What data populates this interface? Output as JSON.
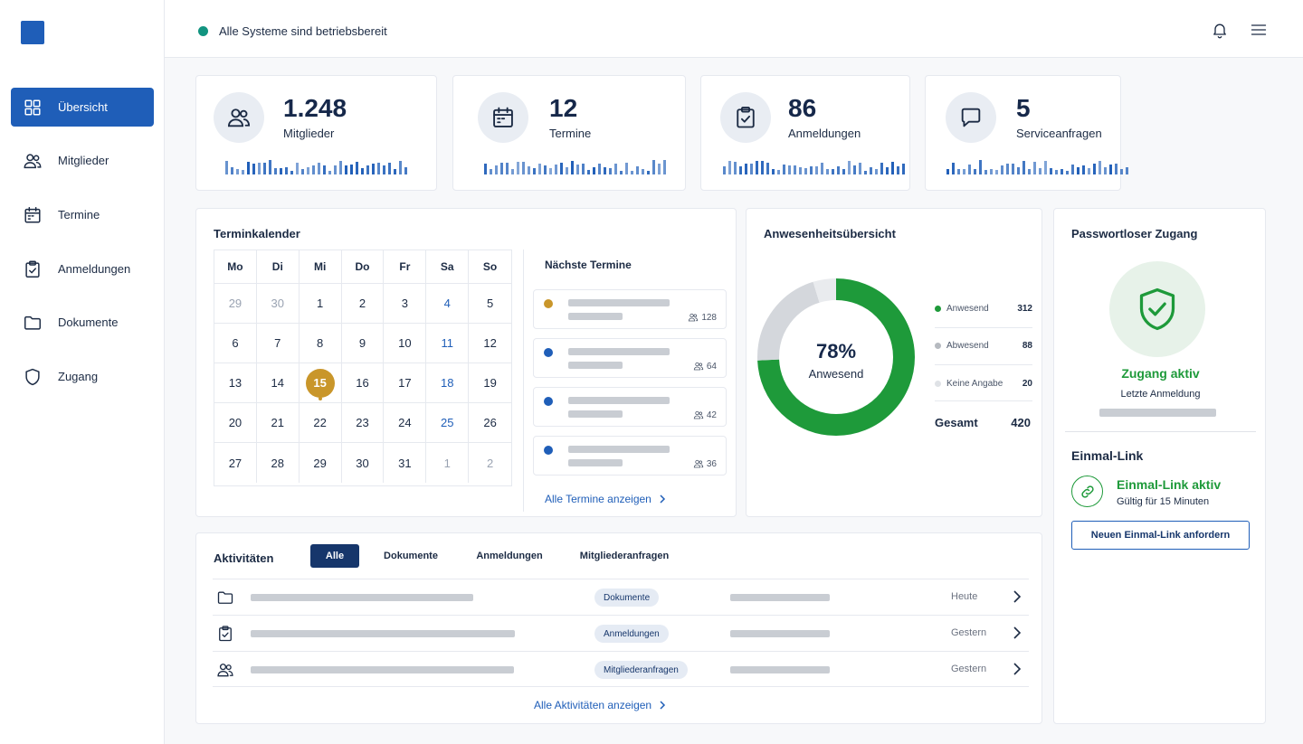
{
  "colors": {
    "primary": "#1f5eb8",
    "dark": "#16366b",
    "status_ok": "#129480",
    "present": "#1e9a3a",
    "absent": "#c0c4ca",
    "unknown": "#e3e6ea",
    "today": "#c9962a"
  },
  "sidebar": {
    "items": [
      {
        "label": "Übersicht",
        "icon": "grid-icon",
        "active": true
      },
      {
        "label": "Mitglieder",
        "icon": "users-icon"
      },
      {
        "label": "Termine",
        "icon": "calendar-icon"
      },
      {
        "label": "Anmeldungen",
        "icon": "clipboard-check-icon"
      },
      {
        "label": "Dokumente",
        "icon": "folder-icon"
      },
      {
        "label": "Zugang",
        "icon": "shield-icon"
      }
    ]
  },
  "topbar": {
    "status": "Alle Systeme sind betriebsbereit"
  },
  "stats": [
    {
      "value": "1.248",
      "label": "Mitglieder",
      "icon": "users-icon"
    },
    {
      "value": "12",
      "label": "Termine",
      "icon": "calendar-icon"
    },
    {
      "value": "86",
      "label": "Anmeldungen",
      "icon": "clipboard-check-icon"
    },
    {
      "value": "5",
      "label": "Serviceanfragen",
      "icon": "chat-icon"
    }
  ],
  "calendar": {
    "title": "Terminkalender",
    "weekdays": [
      "Mo",
      "Di",
      "Mi",
      "Do",
      "Fr",
      "Sa",
      "So"
    ],
    "weeks": [
      [
        "29",
        "30",
        "1",
        "2",
        "3",
        "4",
        "5"
      ],
      [
        "6",
        "7",
        "8",
        "9",
        "10",
        "11",
        "12"
      ],
      [
        "13",
        "14",
        "15",
        "16",
        "17",
        "18",
        "19"
      ],
      [
        "20",
        "21",
        "22",
        "23",
        "24",
        "25",
        "26"
      ],
      [
        "27",
        "28",
        "29",
        "30",
        "31",
        "1",
        "2"
      ]
    ],
    "today": "15"
  },
  "next_appointments": {
    "title": "Nächste Termine",
    "items": [
      {
        "count": "128",
        "dot": "#c9962a"
      },
      {
        "count": "64",
        "dot": "#1f5eb8"
      },
      {
        "count": "42",
        "dot": "#1f5eb8"
      },
      {
        "count": "36",
        "dot": "#1f5eb8"
      }
    ],
    "link": "Alle Termine anzeigen"
  },
  "attendance": {
    "title": "Anwesenheitsübersicht",
    "center_value": "78%",
    "center_label": "Anwesend",
    "legend": [
      {
        "label": "Anwesend",
        "value": "312",
        "color": "#1e9a3a"
      },
      {
        "label": "Abwesend",
        "value": "88",
        "color": "#b6bac0"
      },
      {
        "label": "Keine Angabe",
        "value": "20",
        "color": "#dfe2e6"
      }
    ],
    "total_label": "Gesamt",
    "total_value": "420"
  },
  "access": {
    "title": "Passwortloser Zugang",
    "status": "Zugang aktiv",
    "last_login_label": "Letzte Anmeldung",
    "onetime_title": "Einmal-Link",
    "onetime_status": "Einmal-Link aktiv",
    "onetime_validity": "Gültig für 15 Minuten",
    "request_button": "Neuen Einmal-Link anfordern"
  },
  "activities": {
    "title": "Aktivitäten",
    "tabs": [
      "Alle",
      "Dokumente",
      "Anmeldungen",
      "Mitgliederanfragen"
    ],
    "rows": [
      {
        "icon": "folder-icon",
        "tag": "Dokumente",
        "date": "Heute"
      },
      {
        "icon": "clipboard-check-icon",
        "tag": "Anmeldungen",
        "date": "Gestern"
      },
      {
        "icon": "users-icon",
        "tag": "Mitgliederanfragen",
        "date": "Gestern"
      }
    ],
    "link": "Alle Aktivitäten anzeigen"
  },
  "chart_data": {
    "type": "pie",
    "categories": [
      "Anwesend",
      "Abwesend",
      "Keine Angabe"
    ],
    "values": [
      312,
      88,
      20
    ],
    "title": "Anwesenheitsübersicht"
  }
}
